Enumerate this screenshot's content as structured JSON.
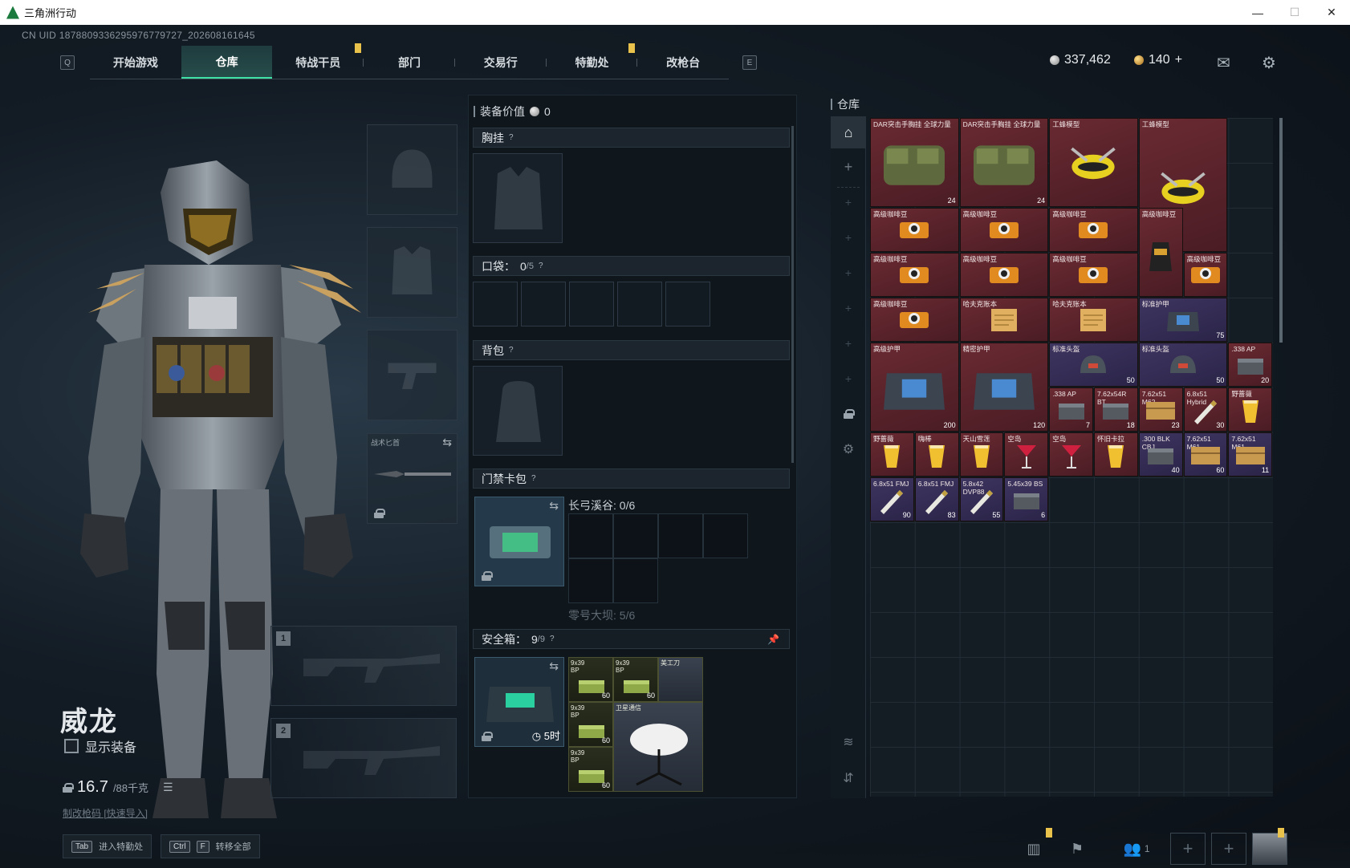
{
  "window": {
    "title": "三角洲行动",
    "min": "—",
    "max": "☐",
    "close": "✕"
  },
  "uid": "CN UID 1878809336295976779727_202608161645",
  "nav": {
    "left_key": "Q",
    "right_key": "E",
    "tabs": [
      "开始游戏",
      "仓库",
      "特战干员",
      "部门",
      "交易行",
      "特勤处",
      "改枪台"
    ],
    "active": 1
  },
  "currency": {
    "silver": "337,462",
    "gold": "140",
    "plus": "+"
  },
  "operator": {
    "name": "威龙",
    "show_equip": "显示装备",
    "weight": "16.7",
    "weight_max": "/88千克",
    "links": "制改枪码  [快速导入]"
  },
  "equip_slots": {
    "melee_label": "战术匕首",
    "weapon1": "1",
    "weapon2": "2"
  },
  "loadout": {
    "title": "装备价值",
    "value": "0",
    "chest": "胸挂",
    "pocket": "口袋：",
    "pocket_count": "0",
    "pocket_max": "/5",
    "backpack": "背包",
    "keycard": "门禁卡包",
    "keycard_area1": "长弓溪谷: 0/6",
    "keycard_area2": "零号大坝: 5/6",
    "safe": "安全箱：",
    "safe_count": "9",
    "safe_max": "/9",
    "safe_time": "5时",
    "help": "?",
    "safe_items": [
      {
        "name": "9x39\nBP",
        "count": "60"
      },
      {
        "name": "9x39\nBP",
        "count": "60"
      },
      {
        "name": "美工刀",
        "count": ""
      },
      {
        "name": "9x39\nBP",
        "count": "60"
      },
      {
        "name": "卫星通信",
        "count": ""
      },
      {
        "name": "9x39\nBP",
        "count": "60"
      }
    ]
  },
  "warehouse": {
    "title": "仓库",
    "items": [
      {
        "name": "DAR突击手胸挂 全球力量",
        "count": "24",
        "rarity": "r-red",
        "icon": "vest"
      },
      {
        "name": "DAR突击手胸挂 全球力量",
        "count": "24",
        "rarity": "r-red",
        "icon": "vest"
      },
      {
        "name": "工蜂模型",
        "count": "",
        "rarity": "r-red",
        "icon": "wasp"
      },
      {
        "name": "工蜂模型",
        "count": "",
        "rarity": "r-red",
        "icon": "wasp"
      },
      {
        "name": "高级咖啡豆",
        "count": "",
        "rarity": "r-red",
        "icon": "coffee"
      },
      {
        "name": "高级咖啡豆",
        "count": "",
        "rarity": "r-red",
        "icon": "coffee"
      },
      {
        "name": "高级咖啡豆",
        "count": "",
        "rarity": "r-red",
        "icon": "coffee"
      },
      {
        "name": "高级咖啡豆",
        "count": "",
        "rarity": "r-red",
        "icon": "coffee-bag"
      },
      {
        "name": "高级咖啡豆",
        "count": "",
        "rarity": "r-red",
        "icon": "coffee"
      },
      {
        "name": "高级咖啡豆",
        "count": "",
        "rarity": "r-red",
        "icon": "coffee"
      },
      {
        "name": "高级咖啡豆",
        "count": "",
        "rarity": "r-red",
        "icon": "coffee"
      },
      {
        "name": "高级咖啡豆",
        "count": "",
        "rarity": "r-red",
        "icon": "coffee"
      },
      {
        "name": "高级咖啡豆",
        "count": "",
        "rarity": "r-red",
        "icon": "coffee"
      },
      {
        "name": "哈夫克账本",
        "count": "",
        "rarity": "r-red",
        "icon": "paper"
      },
      {
        "name": "哈夫克账本",
        "count": "",
        "rarity": "r-red",
        "icon": "paper"
      },
      {
        "name": "标准护甲",
        "count": "75",
        "rarity": "r-purple",
        "icon": "armor"
      },
      {
        "name": "高级护甲",
        "count": "200",
        "rarity": "r-red",
        "icon": "armor"
      },
      {
        "name": "精密护甲",
        "count": "120",
        "rarity": "r-red",
        "icon": "armor"
      },
      {
        "name": "标准头盔",
        "count": "50",
        "rarity": "r-purple",
        "icon": "helmet"
      },
      {
        "name": "标准头盔",
        "count": "50",
        "rarity": "r-purple",
        "icon": "helmet"
      },
      {
        "name": ".338 AP",
        "count": "20",
        "rarity": "r-red",
        "icon": "ammo-box"
      },
      {
        "name": ".338 AP",
        "count": "7",
        "rarity": "r-red",
        "icon": "ammo-box"
      },
      {
        "name": "7.62x54R BT",
        "count": "18",
        "rarity": "r-red",
        "icon": "ammo-box"
      },
      {
        "name": "7.62x51 M62",
        "count": "23",
        "rarity": "r-red",
        "icon": "ammo-crate"
      },
      {
        "name": "6.8x51 Hybrid",
        "count": "30",
        "rarity": "r-red",
        "icon": "cartridge"
      },
      {
        "name": "野蔷薇",
        "count": "",
        "rarity": "r-red",
        "icon": "drink"
      },
      {
        "name": "野蔷薇",
        "count": "",
        "rarity": "r-red",
        "icon": "drink"
      },
      {
        "name": "嗨棒",
        "count": "",
        "rarity": "r-red",
        "icon": "drink"
      },
      {
        "name": "天山雪莲",
        "count": "",
        "rarity": "r-red",
        "icon": "drink"
      },
      {
        "name": "空岛",
        "count": "",
        "rarity": "r-red",
        "icon": "cocktail"
      },
      {
        "name": "空岛",
        "count": "",
        "rarity": "r-red",
        "icon": "cocktail"
      },
      {
        "name": "怀旧卡拉",
        "count": "",
        "rarity": "r-red",
        "icon": "drink"
      },
      {
        "name": ".300 BLK CBJ",
        "count": "40",
        "rarity": "r-purple",
        "icon": "ammo-box"
      },
      {
        "name": "7.62x51 M61",
        "count": "60",
        "rarity": "r-purple",
        "icon": "ammo-crate"
      },
      {
        "name": "7.62x51 M61",
        "count": "11",
        "rarity": "r-purple",
        "icon": "ammo-crate"
      },
      {
        "name": "6.8x51 FMJ",
        "count": "90",
        "rarity": "r-purple",
        "icon": "cartridge"
      },
      {
        "name": "6.8x51 FMJ",
        "count": "83",
        "rarity": "r-purple",
        "icon": "cartridge"
      },
      {
        "name": "5.8x42 DVP88",
        "count": "55",
        "rarity": "r-purple",
        "icon": "cartridge"
      },
      {
        "name": "5.45x39 BS",
        "count": "6",
        "rarity": "r-purple",
        "icon": "ammo-box"
      }
    ]
  },
  "bottom": {
    "hint1_key": "Tab",
    "hint1_text": "进入特勤处",
    "hint2_key1": "Ctrl",
    "hint2_key2": "F",
    "hint2_text": "转移全部",
    "friends": "1"
  }
}
